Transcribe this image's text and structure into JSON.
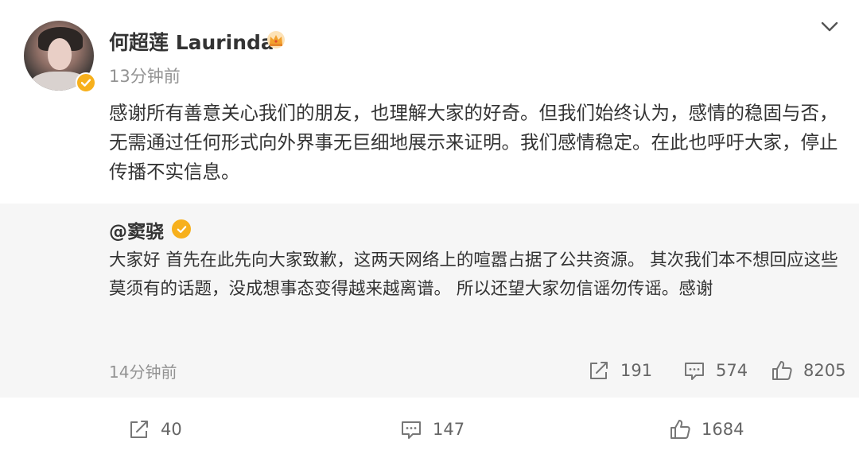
{
  "post": {
    "username": "何超莲 Laurinda",
    "timestamp": "13分钟前",
    "text": "感谢所有善意关心我们的朋友，也理解大家的好奇。但我们始终认为，感情的稳固与否，无需通过任何形式向外界事无巨细地展示来证明。我们感情稳定。在此也呼吁大家，停止传播不实信息。",
    "icons": {
      "avatar": "avatar",
      "verified": "verified-badge-icon",
      "crown": "crown-icon",
      "menu": "chevron-down-icon"
    },
    "colors": {
      "badge": "#f7b01c",
      "repost_bg": "#f6f6f6",
      "muted": "#939393"
    }
  },
  "repost": {
    "author": "@窦骁",
    "text": "大家好 首先在此先向大家致歉，这两天网络上的喧嚣占据了公共资源。 其次我们本不想回应这些莫须有的话题，没成想事态变得越来越离谱。 所以还望大家勿信谣勿传谣。感谢",
    "timestamp": "14分钟前",
    "shares": "191",
    "comments": "574",
    "likes": "8205"
  },
  "footer": {
    "shares": "40",
    "comments": "147",
    "likes": "1684"
  }
}
